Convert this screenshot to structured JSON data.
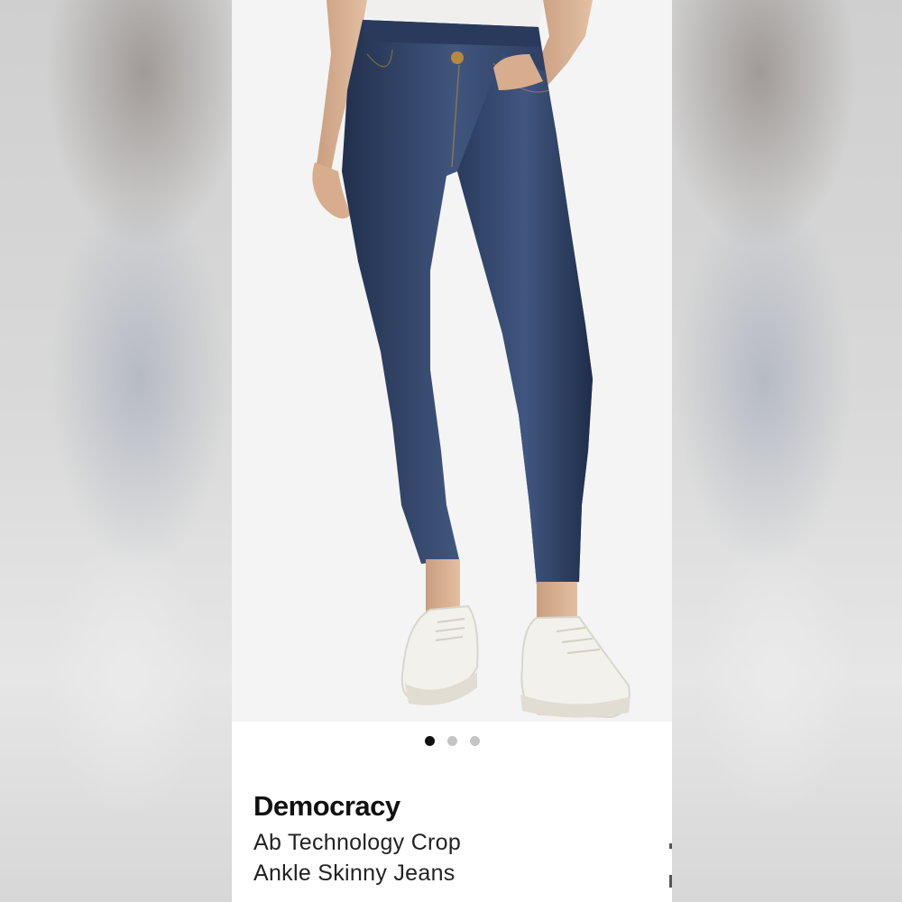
{
  "carousel": {
    "slide_count": 3,
    "active_index": 0,
    "colors": {
      "active_dot": "#111111",
      "inactive_dot": "#c4c4c4"
    }
  },
  "product": {
    "brand": "Democracy",
    "title_line_1": "Ab Technology Crop",
    "title_line_2": "Ankle Skinny Jeans"
  },
  "image": {
    "subject": "product-photo-jeans",
    "colors": {
      "denim": "#2f3f5f",
      "sneaker": "#f3f1ec",
      "background": "#f4f4f4"
    }
  }
}
